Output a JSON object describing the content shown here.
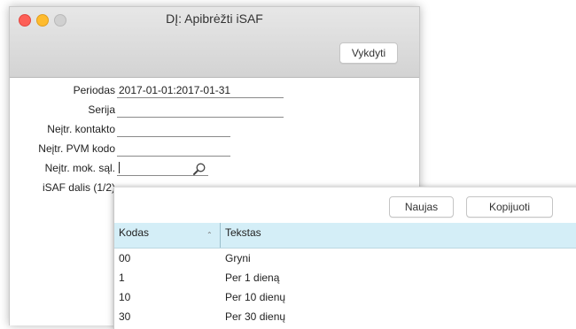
{
  "window": {
    "title": "DĮ: Apibrėžti iSAF",
    "run_button": "Vykdyti"
  },
  "form": {
    "periodas": {
      "label": "Periodas",
      "value": "2017-01-01:2017-01-31"
    },
    "serija": {
      "label": "Serija",
      "value": ""
    },
    "kontakto": {
      "label": "Neįtr. kontakto",
      "value": ""
    },
    "pvm": {
      "label": "Neįtr. PVM kodo",
      "value": ""
    },
    "mok_sal": {
      "label": "Neįtr. mok. sąl.",
      "value": ""
    },
    "dalis": {
      "label": "iSAF dalis (1/2)"
    }
  },
  "popup": {
    "new_button": "Naujas",
    "copy_button": "Kopijuoti",
    "columns": {
      "kodas": "Kodas",
      "tekstas": "Tekstas"
    },
    "rows": [
      {
        "kodas": "00",
        "tekstas": "Gryni"
      },
      {
        "kodas": "1",
        "tekstas": "Per 1 dieną"
      },
      {
        "kodas": "10",
        "tekstas": "Per 10 dienų"
      },
      {
        "kodas": "30",
        "tekstas": "Per 30 dienų"
      }
    ]
  },
  "icons": {
    "close": "close-icon",
    "minimize": "minimize-icon",
    "zoom": "zoom-icon",
    "lookup": "magnifier-icon",
    "sort": "sort-ascending-icon"
  },
  "colors": {
    "header_bg": "#d4eef7",
    "traffic_red": "#fd5f57",
    "traffic_yellow": "#febb2e"
  }
}
